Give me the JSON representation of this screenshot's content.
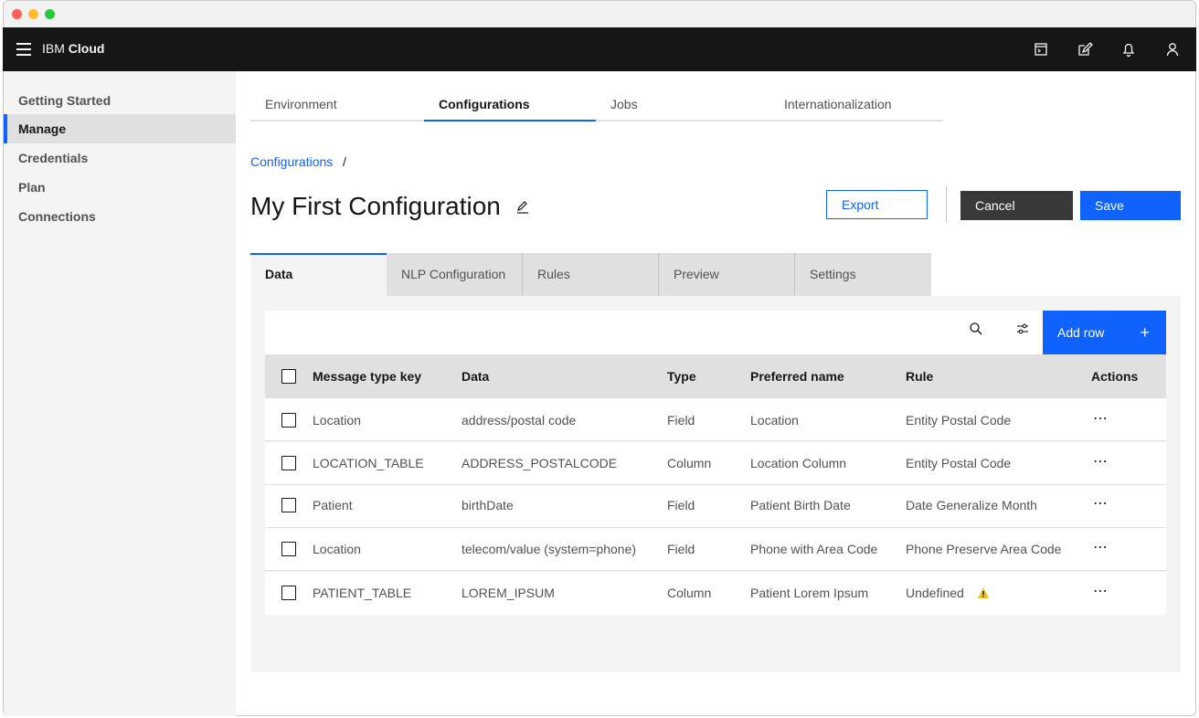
{
  "window": {
    "dot_colors": [
      "#ff5f57",
      "#febc2e",
      "#28c840"
    ]
  },
  "header": {
    "brand_prefix": "IBM",
    "brand_name": "Cloud",
    "icons": [
      "hamburger-icon",
      "terminal-icon",
      "edit-icon",
      "notification-icon",
      "user-icon"
    ]
  },
  "sidebar": {
    "items": [
      {
        "label": "Getting Started"
      },
      {
        "label": "Manage",
        "active": true
      },
      {
        "label": "Credentials"
      },
      {
        "label": "Plan"
      },
      {
        "label": "Connections"
      }
    ]
  },
  "top_tabs": [
    {
      "label": "Environment"
    },
    {
      "label": "Configurations",
      "active": true
    },
    {
      "label": "Jobs"
    },
    {
      "label": "Internationalization"
    }
  ],
  "breadcrumb": {
    "link": "Configurations",
    "separator": "/"
  },
  "page": {
    "title": "My First Configuration"
  },
  "actions": {
    "export": "Export",
    "cancel": "Cancel",
    "save": "Save"
  },
  "content_tabs": [
    {
      "label": "Data",
      "active": true
    },
    {
      "label": "NLP Configuration"
    },
    {
      "label": "Rules"
    },
    {
      "label": "Preview"
    },
    {
      "label": "Settings"
    }
  ],
  "toolbar": {
    "add_row": "Add row",
    "add_icon": "+"
  },
  "table": {
    "headers": [
      "Message type key",
      "Data",
      "Type",
      "Preferred name",
      "Rule",
      "Actions"
    ],
    "rows": [
      {
        "key": "Location",
        "data": "address/postal code",
        "type": "Field",
        "preferred": "Location",
        "rule": "Entity Postal Code",
        "warning": false
      },
      {
        "key": "LOCATION_TABLE",
        "data": "ADDRESS_POSTALCODE",
        "type": "Column",
        "preferred": "Location Column",
        "rule": "Entity Postal Code",
        "warning": false
      },
      {
        "key": "Patient",
        "data": "birthDate",
        "type": "Field",
        "preferred": "Patient Birth Date",
        "rule": "Date Generalize Month",
        "warning": false
      },
      {
        "key": "Location",
        "data": "telecom/value (system=phone)",
        "type": "Field",
        "preferred": "Phone with Area Code",
        "rule": "Phone Preserve Area Code",
        "warning": false
      },
      {
        "key": "PATIENT_TABLE",
        "data": "LOREM_IPSUM",
        "type": "Column",
        "preferred": "Patient Lorem Ipsum",
        "rule": "Undefined",
        "warning": true
      }
    ],
    "overflow_label": "⋯"
  },
  "colors": {
    "accent": "#0f62fe",
    "warning": "#f1c21b",
    "header_bg": "#161616"
  }
}
